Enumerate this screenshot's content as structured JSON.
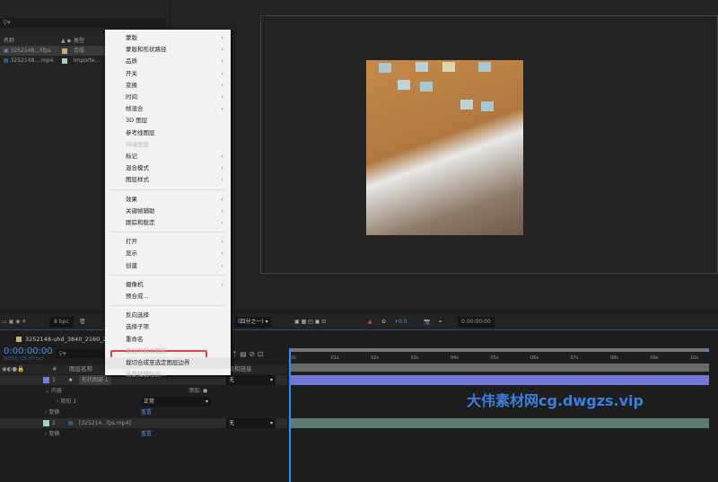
{
  "project": {
    "search_placeholder": "",
    "col_name": "名称",
    "col_type": "类型",
    "items": [
      {
        "name": "3252148...5fps",
        "type": "合成",
        "label_color": "#c9b27a"
      },
      {
        "name": "3252148....mp4",
        "type": "Importe...",
        "label_color": "#9fd0cc"
      }
    ]
  },
  "toolbar": {
    "bpc": "8 bpc",
    "resolution": "(四分之一)",
    "exposure": "+0.0",
    "timecode": "0:00:00:00"
  },
  "timeline": {
    "tab": "3252148-uhd_3840_2160_25fps",
    "time": "0:00:00:00",
    "fps": "00000 (25.00 fps)",
    "col_layer_name": "图层名称",
    "col_parent": "父级和链接",
    "col_num": "#",
    "layers": [
      {
        "num": "1",
        "name": "形状图层 1",
        "parent": "无",
        "color": "#6f7fe8"
      },
      {
        "num": "2",
        "name": "[325214...fps.mp4]",
        "parent": "无",
        "color": "#9fd0cc"
      }
    ],
    "contents": "内容",
    "add": "添加:",
    "rect": "矩形 1",
    "blend": "正常",
    "transform": "变换",
    "reset": "重置",
    "ticks": [
      "0s",
      "01s",
      "02s",
      "03s",
      "04s",
      "05s",
      "06s",
      "07s",
      "08s",
      "09s",
      "10s"
    ]
  },
  "menu": {
    "groups": [
      [
        {
          "label": "蒙版",
          "sub": true
        },
        {
          "label": "蒙版和形状路径",
          "sub": true
        },
        {
          "label": "品质",
          "sub": true
        },
        {
          "label": "开关",
          "sub": true
        },
        {
          "label": "变换",
          "sub": true
        },
        {
          "label": "时间",
          "sub": true
        },
        {
          "label": "帧混合",
          "sub": true
        },
        {
          "label": "3D 图层"
        },
        {
          "label": "参考线图层"
        },
        {
          "label": "环境图层",
          "disabled": true
        },
        {
          "label": "标记",
          "sub": true
        },
        {
          "label": "混合模式",
          "sub": true
        },
        {
          "label": "图层样式",
          "sub": true
        }
      ],
      [
        {
          "label": "效果",
          "sub": true
        },
        {
          "label": "关键帧辅助",
          "sub": true
        },
        {
          "label": "跟踪和稳定",
          "sub": true
        }
      ],
      [
        {
          "label": "打开",
          "sub": true
        },
        {
          "label": "显示",
          "sub": true
        },
        {
          "label": "创建",
          "sub": true
        }
      ],
      [
        {
          "label": "摄像机",
          "sub": true
        },
        {
          "label": "预合成..."
        }
      ],
      [
        {
          "label": "反向选择"
        },
        {
          "label": "选择子项"
        },
        {
          "label": "重命名"
        },
        {
          "label": "添加到基本图形",
          "disabled": true
        },
        {
          "label": "裁切合成至选定图层边界",
          "highlighted": true
        },
        {
          "label": "场景编辑检测...",
          "disabled": true
        }
      ]
    ]
  },
  "watermark": "大伟素材网cg.dwgzs.vip"
}
